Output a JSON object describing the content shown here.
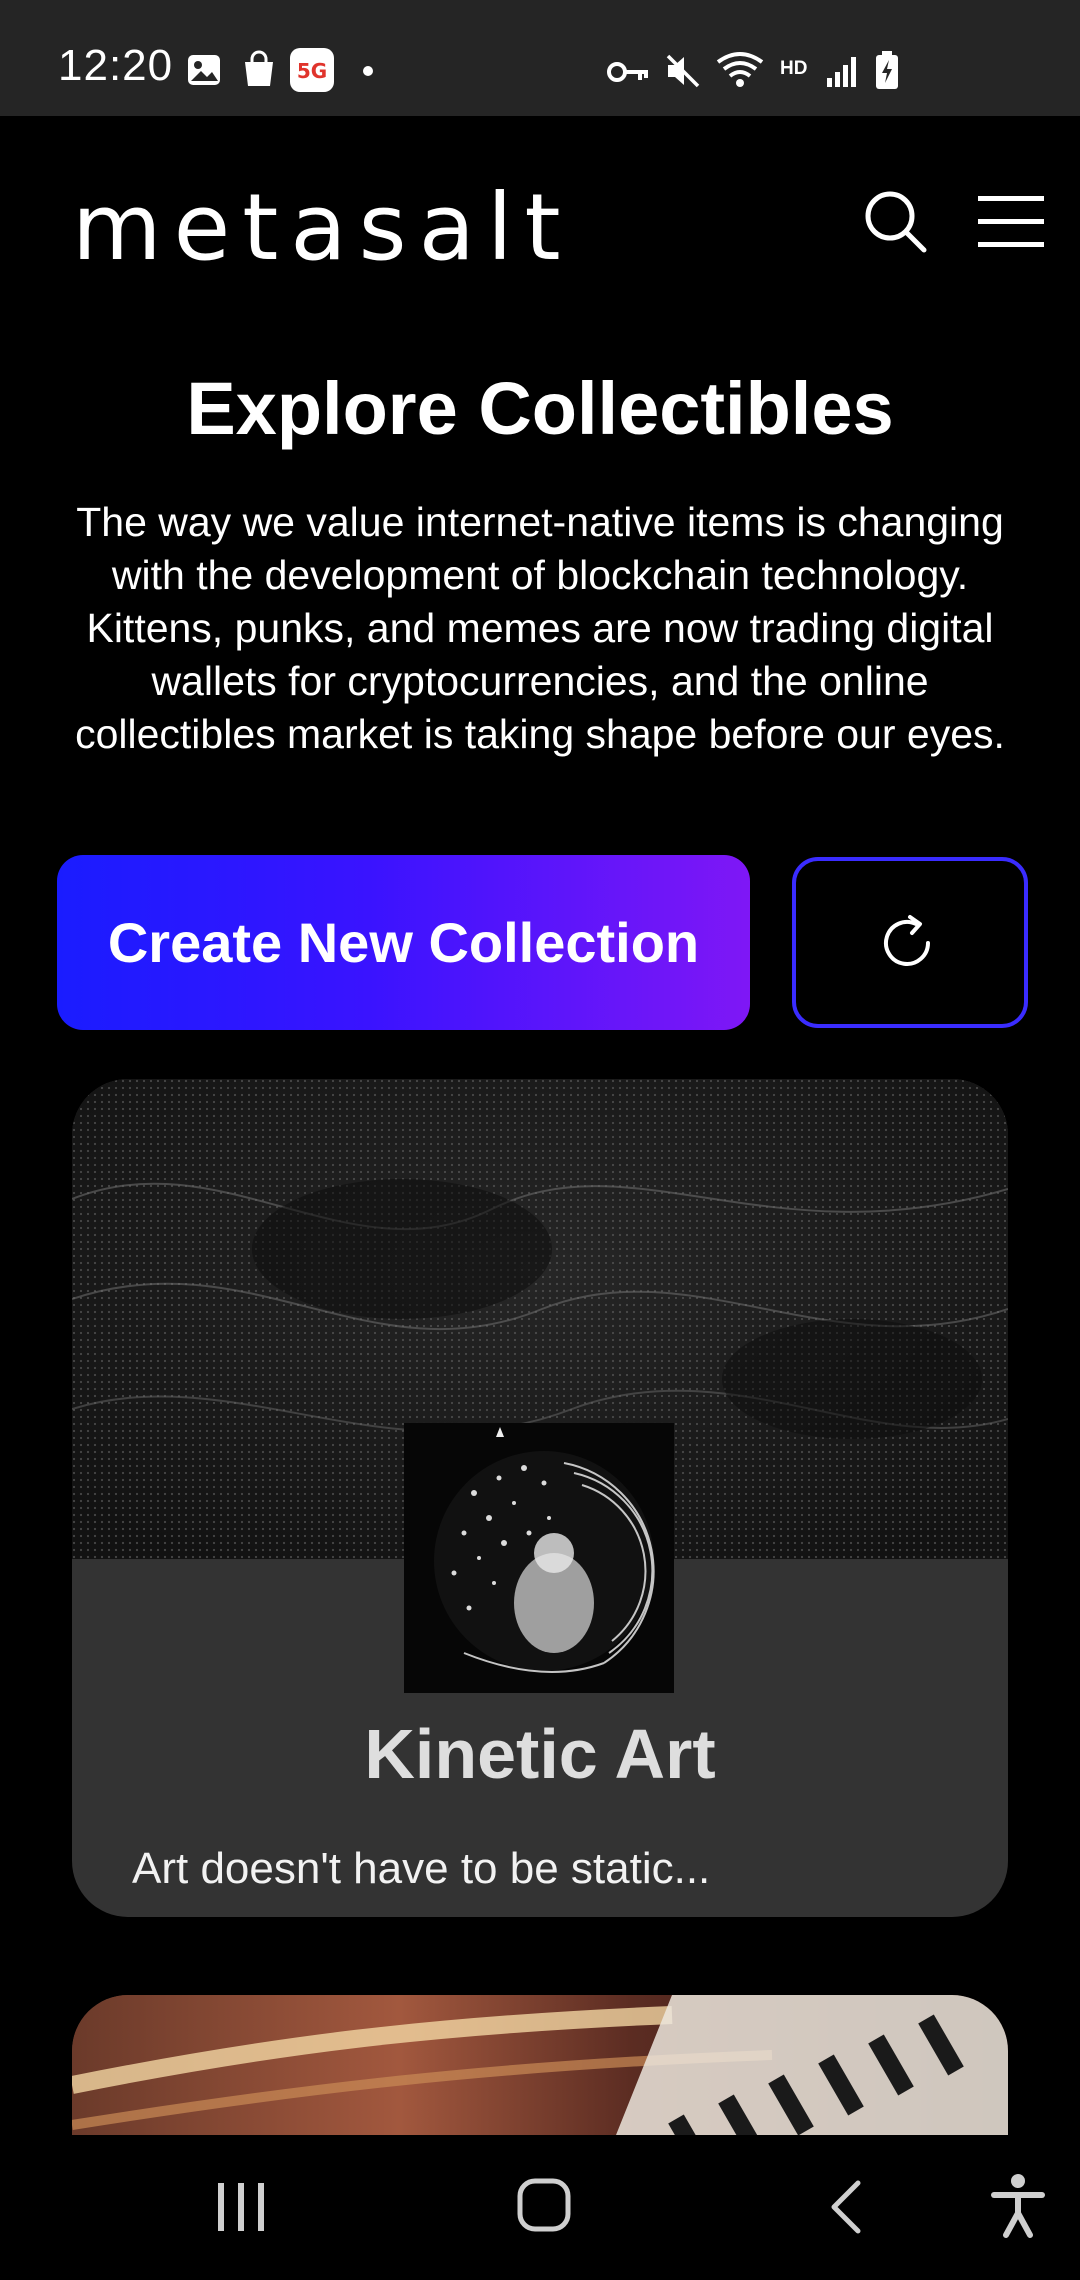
{
  "status_bar": {
    "time": "12:20",
    "left_icons": [
      "gallery-icon",
      "shopping-bag-icon",
      "5g-app-icon",
      "notification-dot-icon"
    ],
    "right_icons": [
      "vpn-key-icon",
      "mute-icon",
      "wifi-icon",
      "hd-icon",
      "signal-icon",
      "battery-charging-icon"
    ],
    "hd_label": "HD",
    "badge_5g": "5G"
  },
  "header": {
    "logo": "metasalt",
    "search_icon": "search-icon",
    "menu_icon": "hamburger-menu-icon"
  },
  "hero": {
    "title": "Explore Collectibles",
    "description": "The way we value internet-native items is changing with the development of blockchain technology. Kittens, punks, and memes are now trading digital wallets for cryptocurrencies, and the online collectibles market is taking shape before our eyes."
  },
  "actions": {
    "create_label": "Create New Collection",
    "refresh_icon": "refresh-icon"
  },
  "collections": [
    {
      "title": "Kinetic Art",
      "description": "Art doesn't have to be static..."
    }
  ],
  "nav_bar": {
    "items": [
      "recent-apps-icon",
      "home-icon",
      "back-icon",
      "accessibility-icon"
    ]
  },
  "colors": {
    "status_bar_bg": "#252525",
    "page_bg": "#000000",
    "card_bg": "#333333",
    "button_gradient_start": "#1a1cff",
    "button_gradient_end": "#7f17f6",
    "refresh_border": "#3a2cff"
  }
}
